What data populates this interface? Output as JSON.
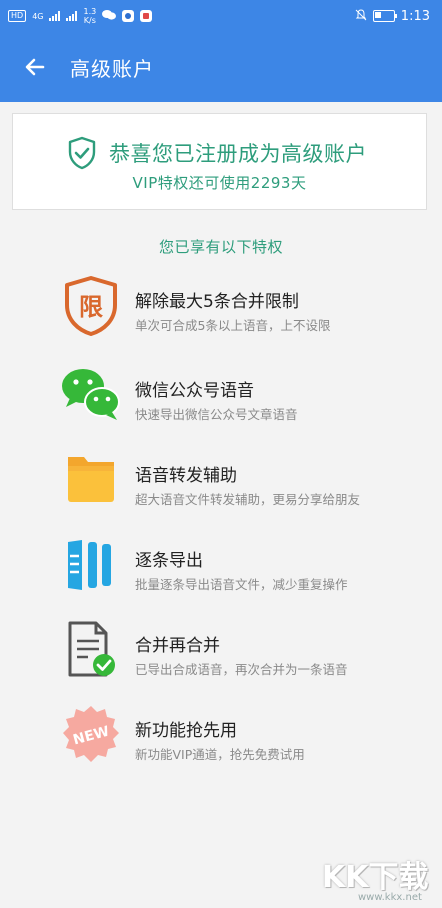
{
  "status_bar": {
    "network_chip": "HD",
    "signal1_label": "4G",
    "speed_value": "1.3",
    "speed_unit": "K/s",
    "time": "1:13"
  },
  "app_bar": {
    "title": "高级账户"
  },
  "card": {
    "title": "恭喜您已注册成为高级账户",
    "subtitle": "VIP特权还可使用2293天"
  },
  "section_title": "您已享有以下特权",
  "features": [
    {
      "title": "解除最大5条合并限制",
      "desc": "单次可合成5条以上语音，上不设限",
      "icon": "limit-shield-icon",
      "badge": "限"
    },
    {
      "title": "微信公众号语音",
      "desc": "快速导出微信公众号文章语音",
      "icon": "wechat-icon"
    },
    {
      "title": "语音转发辅助",
      "desc": "超大语音文件转发辅助，更易分享给朋友",
      "icon": "folder-icon"
    },
    {
      "title": "逐条导出",
      "desc": "批量逐条导出语音文件，减少重复操作",
      "icon": "export-icon"
    },
    {
      "title": "合并再合并",
      "desc": "已导出合成语音，再次合并为一条语音",
      "icon": "document-check-icon"
    },
    {
      "title": "新功能抢先用",
      "desc": "新功能VIP通道，抢先免费试用",
      "icon": "new-badge-icon",
      "badge": "NEW"
    }
  ],
  "watermark": {
    "text": "KK下载",
    "url": "www.kkx.net"
  },
  "colors": {
    "primary": "#3d86e6",
    "accent_green": "#2e9d7c",
    "background": "#f3f3f3"
  }
}
